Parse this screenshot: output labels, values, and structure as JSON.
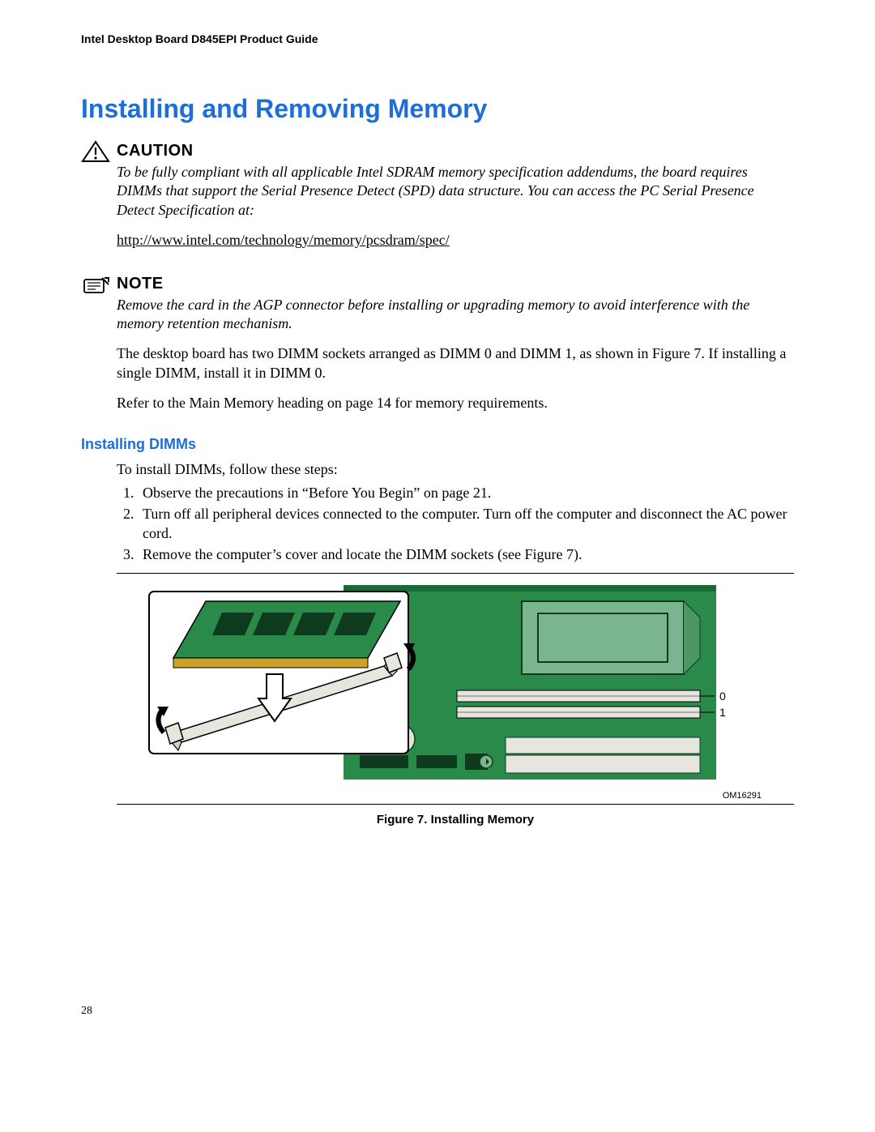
{
  "header": {
    "running": "Intel Desktop Board D845EPI Product Guide"
  },
  "title": "Installing and Removing Memory",
  "caution": {
    "label": "CAUTION",
    "text": "To be fully compliant with all applicable Intel SDRAM memory specification addendums, the board requires DIMMs that support the Serial Presence Detect (SPD) data structure.  You can access the PC Serial Presence Detect Specification at:",
    "link": "http://www.intel.com/technology/memory/pcsdram/spec/"
  },
  "note": {
    "label": "NOTE",
    "text": "Remove the card in the AGP connector before installing or upgrading memory to avoid interference with the memory retention mechanism."
  },
  "paragraphs": {
    "p1": "The desktop board has two DIMM sockets arranged as DIMM 0 and DIMM 1, as shown in Figure 7.  If installing a single DIMM, install it in DIMM 0.",
    "p2": "Refer to the Main Memory heading on page 14 for memory requirements."
  },
  "subheading": "Installing DIMMs",
  "steps": {
    "intro": "To install DIMMs, follow these steps:",
    "items": [
      "Observe the precautions in “Before You Begin” on page 21.",
      "Turn off all peripheral devices connected to the computer.  Turn off the computer and disconnect the AC power cord.",
      "Remove the computer’s cover and locate the DIMM sockets (see Figure 7)."
    ]
  },
  "figure": {
    "caption": "Figure 7.  Installing Memory",
    "id": "OM16291",
    "labels": {
      "dimm0": "0",
      "dimm1": "1"
    }
  },
  "pageNumber": "28"
}
